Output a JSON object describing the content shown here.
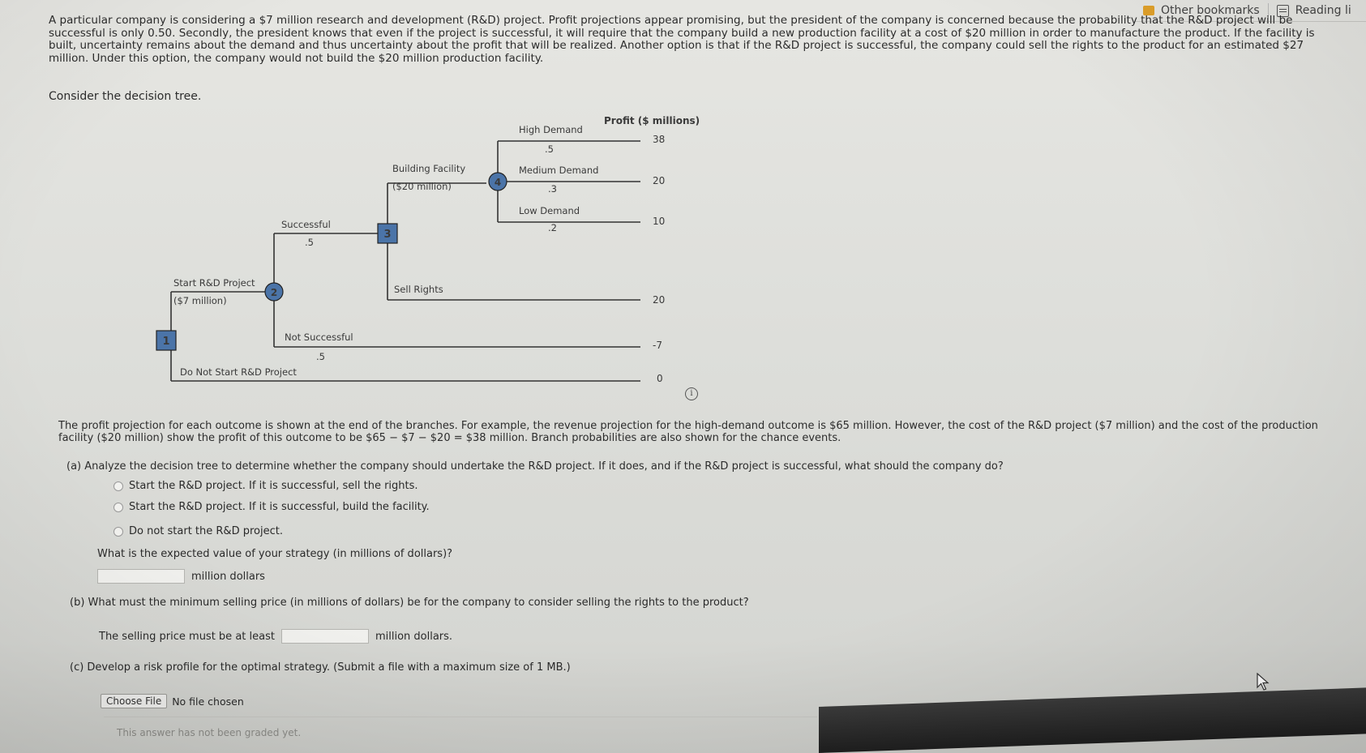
{
  "browser": {
    "bookmarks": [
      {
        "label": "Other bookmarks",
        "icon": "folder-icon"
      },
      {
        "label": "Reading li",
        "icon": "reading-list-icon"
      }
    ]
  },
  "problem": {
    "intro": "A particular company is considering a $7 million research and development (R&D) project. Profit projections appear promising, but the president of the company is concerned because the probability that the R&D project will be successful is only 0.50. Secondly, the president knows that even if the project is successful, it will require that the company build a new production facility at a cost of $20 million in order to manufacture the product. If the facility is built, uncertainty remains about the demand and thus uncertainty about the profit that will be realized. Another option is that if the R&D project is successful, the company could sell the rights to the product for an estimated $27 million. Under this option, the company would not build the $20 million production facility.",
    "consider": "Consider the decision tree."
  },
  "tree": {
    "profit_header": "Profit ($ millions)",
    "nodes": {
      "n1": "1",
      "n2": "2",
      "n3": "3",
      "n4": "4"
    },
    "branches": {
      "start_rd": "Start R&D Project",
      "start_rd_cost": "($7 million)",
      "do_not_start": "Do Not Start R&D Project",
      "successful": "Successful",
      "successful_p": ".5",
      "not_successful": "Not Successful",
      "not_successful_p": ".5",
      "building": "Building Facility",
      "building_cost": "($20 million)",
      "sell_rights": "Sell Rights",
      "high": "High Demand",
      "high_p": ".5",
      "medium": "Medium Demand",
      "medium_p": ".3",
      "low": "Low Demand",
      "low_p": ".2"
    },
    "payoffs": {
      "high": "38",
      "medium": "20",
      "low": "10",
      "sell": "20",
      "not_successful": "-7",
      "do_not_start": "0"
    }
  },
  "profit_text": "The profit projection for each outcome is shown at the end of the branches. For example, the revenue projection for the high-demand outcome is $65 million. However, the cost of the R&D project ($7 million) and the cost of the production facility ($20 million) show the profit of this outcome to be $65 − $7 − $20 = $38 million. Branch probabilities are also shown for the chance events.",
  "part_a": {
    "question": "(a)  Analyze the decision tree to determine whether the company should undertake the R&D project. If it does, and if the R&D project is successful, what should the company do?",
    "options": [
      "Start the R&D project. If it is successful, sell the rights.",
      "Start the R&D project. If it is successful, build the facility.",
      "Do not start the R&D project."
    ],
    "ev_question": "What is the expected value of your strategy (in millions of dollars)?",
    "ev_unit": "million dollars"
  },
  "part_b": {
    "question": "(b)  What must the minimum selling price (in millions of dollars) be for the company to consider selling the rights to the product?",
    "prefix": "The selling price must be at least",
    "suffix": "million dollars."
  },
  "part_c": {
    "question": "(c)  Develop a risk profile for the optimal strategy. (Submit a file with a maximum size of 1 MB.)",
    "choose": "Choose File",
    "no_file": "No file chosen",
    "graded": "This answer has not been graded yet."
  }
}
